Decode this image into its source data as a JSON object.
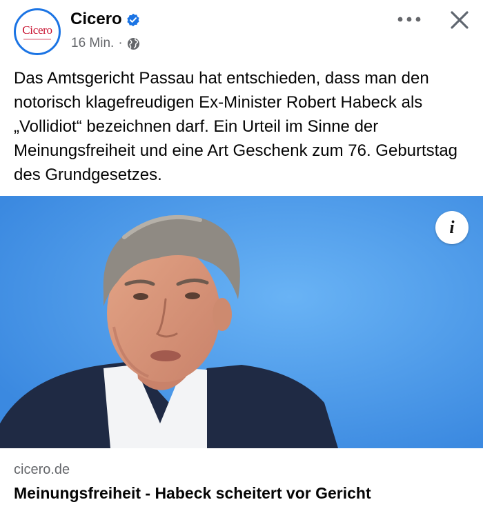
{
  "post": {
    "page_name": "Cicero",
    "avatar_text": "Cicero",
    "timestamp": "16 Min.",
    "separator": "·",
    "text": "Das Amtsgericht Passau hat entschieden, dass man den notorisch klagefreudigen Ex-Minister Robert Habeck als „Vollidiot“ bezeichnen darf. Ein Urteil im Sinne der Meinungsfreiheit und eine Art Geschenk zum 76. Geburtstag des Grundgesetzes.",
    "icons": {
      "verified": "verified-badge-icon",
      "audience": "globe-icon",
      "more": "more-options-icon",
      "close": "close-icon",
      "info": "info-icon"
    },
    "info_glyph": "i",
    "colors": {
      "verified": "#1b74e4",
      "brand_red": "#c8102e",
      "image_background": "#4a9aec"
    }
  },
  "link_preview": {
    "domain": "cicero.de",
    "title": "Meinungsfreiheit - Habeck scheitert vor Gericht"
  }
}
